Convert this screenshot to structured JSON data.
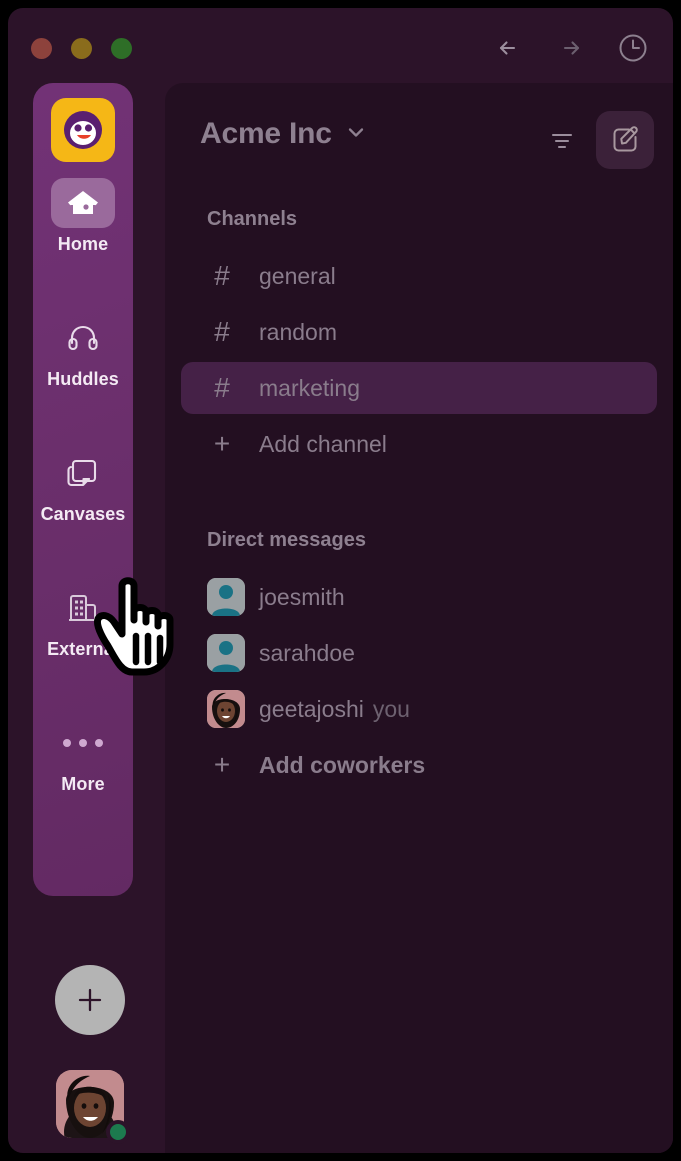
{
  "window": {
    "traffic_lights": [
      {
        "name": "close",
        "color": "#8d423c"
      },
      {
        "name": "minimize",
        "color": "#8a6c1c"
      },
      {
        "name": "zoom",
        "color": "#2e6e27"
      }
    ],
    "nav": [
      {
        "name": "back-button",
        "icon": "arrow-left-icon"
      },
      {
        "name": "forward-button",
        "icon": "arrow-right-icon"
      },
      {
        "name": "history-button",
        "icon": "clock-icon"
      }
    ],
    "background": "#2c1329"
  },
  "rail": {
    "background": "#6b2f6c",
    "logo": {
      "icon": "workspace-logo-icon",
      "background": "#f5b716",
      "mark_color": "#5a1f70"
    },
    "items": [
      {
        "label": "Home",
        "icon": "home-icon",
        "active": true
      },
      {
        "label": "Huddles",
        "icon": "headphones-icon",
        "active": false
      },
      {
        "label": "Canvases",
        "icon": "canvas-icon",
        "active": false
      },
      {
        "label": "External",
        "icon": "building-icon",
        "active": false
      },
      {
        "label": "More",
        "icon": "ellipsis-icon",
        "active": false
      }
    ],
    "add_button": {
      "icon": "plus-icon",
      "background": "#b4b4b4"
    },
    "user_avatar": {
      "icon": "user-avatar",
      "presence": "online",
      "presence_color": "#1c7a4e"
    }
  },
  "sidebar": {
    "background": "#230f21",
    "header": {
      "workspace_name": "Acme Inc",
      "chevron": "chevron-down-icon",
      "filter_icon": "filter-icon",
      "compose_icon": "compose-icon"
    },
    "channels": {
      "title": "Channels",
      "items": [
        {
          "glyph": "#",
          "label": "general",
          "selected": false
        },
        {
          "glyph": "#",
          "label": "random",
          "selected": false
        },
        {
          "glyph": "#",
          "label": "marketing",
          "selected": true
        },
        {
          "glyph": "+",
          "label": "Add channel",
          "selected": false,
          "action": true
        }
      ]
    },
    "direct_messages": {
      "title": "Direct messages",
      "items": [
        {
          "avatar": "placeholder",
          "label": "joesmith",
          "suffix": ""
        },
        {
          "avatar": "placeholder",
          "label": "sarahdoe",
          "suffix": ""
        },
        {
          "avatar": "photo",
          "label": "geetajoshi",
          "suffix": "you"
        }
      ],
      "add": {
        "glyph": "+",
        "label": "Add coworkers"
      }
    },
    "selected_color": "#452147"
  },
  "cursor": {
    "type": "pointing-hand"
  }
}
